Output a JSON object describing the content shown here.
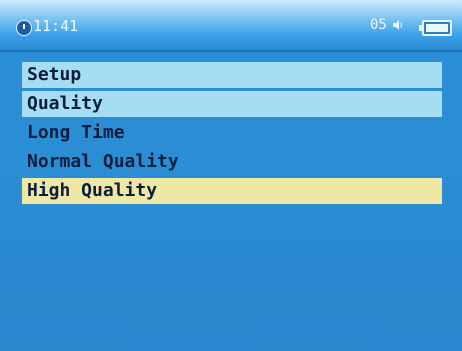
{
  "status": {
    "time": "11:41",
    "volume": "05"
  },
  "icons": {
    "clock": "clock-icon",
    "speaker": "speaker-icon",
    "battery": "battery-icon"
  },
  "menu": {
    "items": [
      {
        "label": "Setup",
        "style": "header"
      },
      {
        "label": "Quality",
        "style": "header"
      },
      {
        "label": "Long Time",
        "style": "option"
      },
      {
        "label": "Normal Quality",
        "style": "option"
      },
      {
        "label": "High Quality",
        "style": "selected"
      }
    ]
  },
  "colors": {
    "background": "#2a8fd6",
    "header_row": "#a7dcf5",
    "selected_row": "#efe8a4",
    "text": "#0b1e3c"
  }
}
